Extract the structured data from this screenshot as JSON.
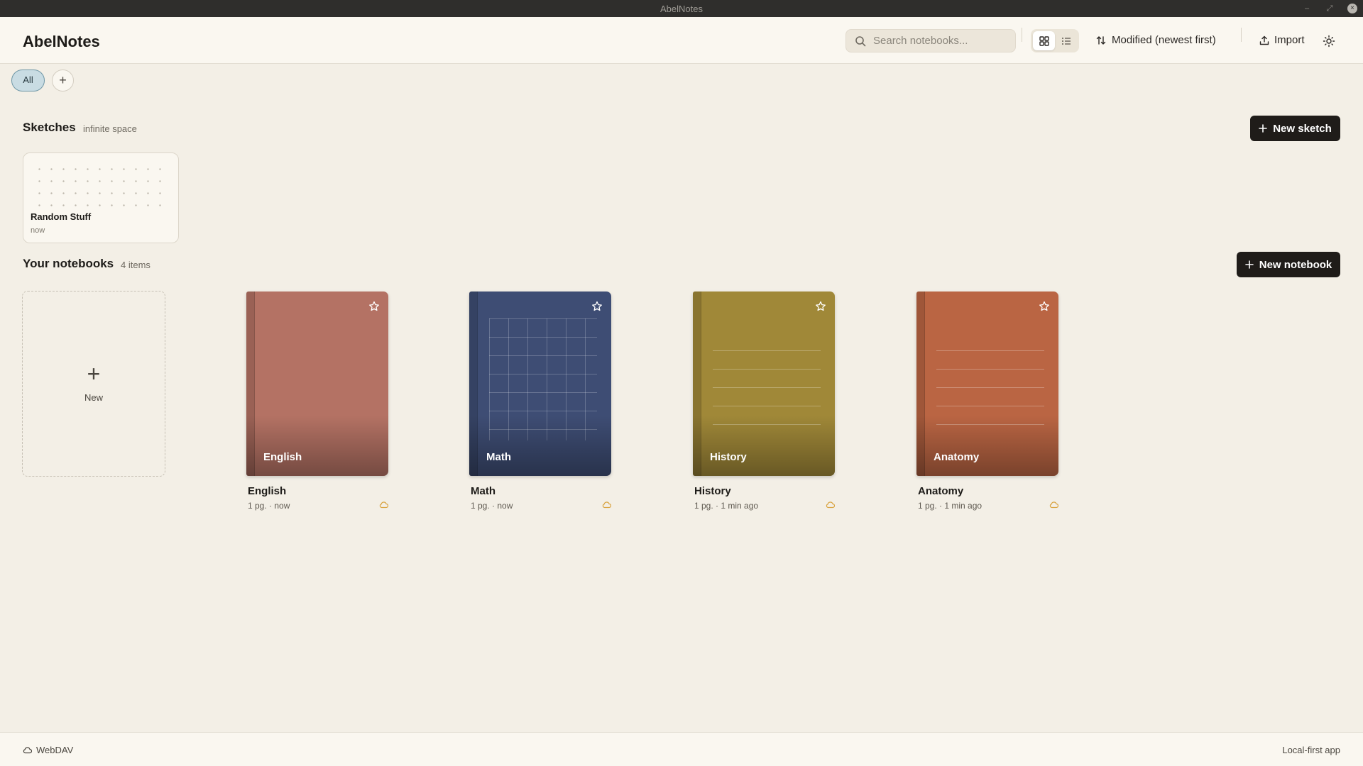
{
  "window": {
    "title": "AbelNotes",
    "minimize_glyph": "–",
    "maximize_glyph": "⤢",
    "close_glyph": "×"
  },
  "header": {
    "app_title": "AbelNotes",
    "search_placeholder": "Search notebooks...",
    "search_value": "",
    "view_mode": "grid",
    "sort_label": "Modified (newest first)",
    "import_label": "Import"
  },
  "tags": {
    "items": [
      {
        "label": "All",
        "active": true
      }
    ],
    "add_glyph": "+"
  },
  "sketches": {
    "title": "Sketches",
    "subtitle": "infinite space",
    "new_button": "New sketch",
    "items": [
      {
        "title": "Random Stuff",
        "time": "now"
      }
    ]
  },
  "notebooks": {
    "title": "Your notebooks",
    "count_label": "4 items",
    "new_button": "New notebook",
    "new_card_plus": "+",
    "new_card_label": "New",
    "items": [
      {
        "name": "English",
        "cover_label": "English",
        "meta": "1 pg. · now",
        "color": "#b47264",
        "pattern": "plain"
      },
      {
        "name": "Math",
        "cover_label": "Math",
        "meta": "1 pg. · now",
        "color": "#3e4d74",
        "pattern": "grid"
      },
      {
        "name": "History",
        "cover_label": "History",
        "meta": "1 pg. · 1 min ago",
        "color": "#a08838",
        "pattern": "lined"
      },
      {
        "name": "Anatomy",
        "cover_label": "Anatomy",
        "meta": "1 pg. · 1 min ago",
        "color": "#ba6543",
        "pattern": "lined"
      }
    ]
  },
  "footer": {
    "sync_label": "WebDAV",
    "right_label": "Local-first app"
  },
  "colors": {
    "background": "#f3efe6",
    "header": "#faf7f0",
    "accent_dark": "#1f1c19",
    "tag_active": "#c9dce3",
    "sync_icon": "#d9a441"
  }
}
